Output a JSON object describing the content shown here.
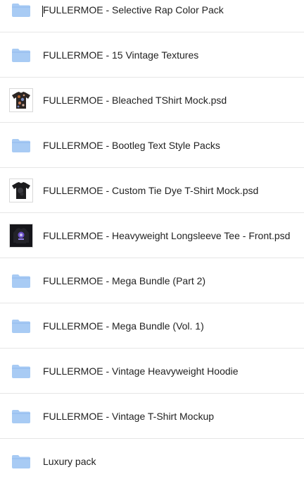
{
  "colors": {
    "folder": "#a8cbf4",
    "folder_tab": "#8fb9ee",
    "text": "#222222",
    "divider": "#e6e6e6"
  },
  "files": [
    {
      "name": "FULLERMOE - Selective Rap Color Pack",
      "kind": "folder",
      "icon": "folder-icon"
    },
    {
      "name": "FULLERMOE - 15 Vintage Textures",
      "kind": "folder",
      "icon": "folder-icon"
    },
    {
      "name": "FULLERMOE - Bleached TShirt Mock.psd",
      "kind": "image",
      "icon": "bleached-tshirt-thumbnail"
    },
    {
      "name": "FULLERMOE - Bootleg Text Style Packs",
      "kind": "folder",
      "icon": "folder-icon"
    },
    {
      "name": "FULLERMOE - Custom Tie Dye T-Shirt Mock.psd",
      "kind": "image",
      "icon": "tie-dye-tshirt-thumbnail"
    },
    {
      "name": "FULLERMOE - Heavyweight Longsleeve Tee - Front.psd",
      "kind": "image",
      "icon": "longsleeve-tee-thumbnail"
    },
    {
      "name": "FULLERMOE - Mega Bundle (Part 2)",
      "kind": "folder",
      "icon": "folder-icon"
    },
    {
      "name": "FULLERMOE - Mega Bundle (Vol. 1)",
      "kind": "folder",
      "icon": "folder-icon"
    },
    {
      "name": "FULLERMOE - Vintage Heavyweight Hoodie",
      "kind": "folder",
      "icon": "folder-icon"
    },
    {
      "name": "FULLERMOE - Vintage T-Shirt Mockup",
      "kind": "folder",
      "icon": "folder-icon"
    },
    {
      "name": "Luxury pack",
      "kind": "folder",
      "icon": "folder-icon"
    }
  ]
}
